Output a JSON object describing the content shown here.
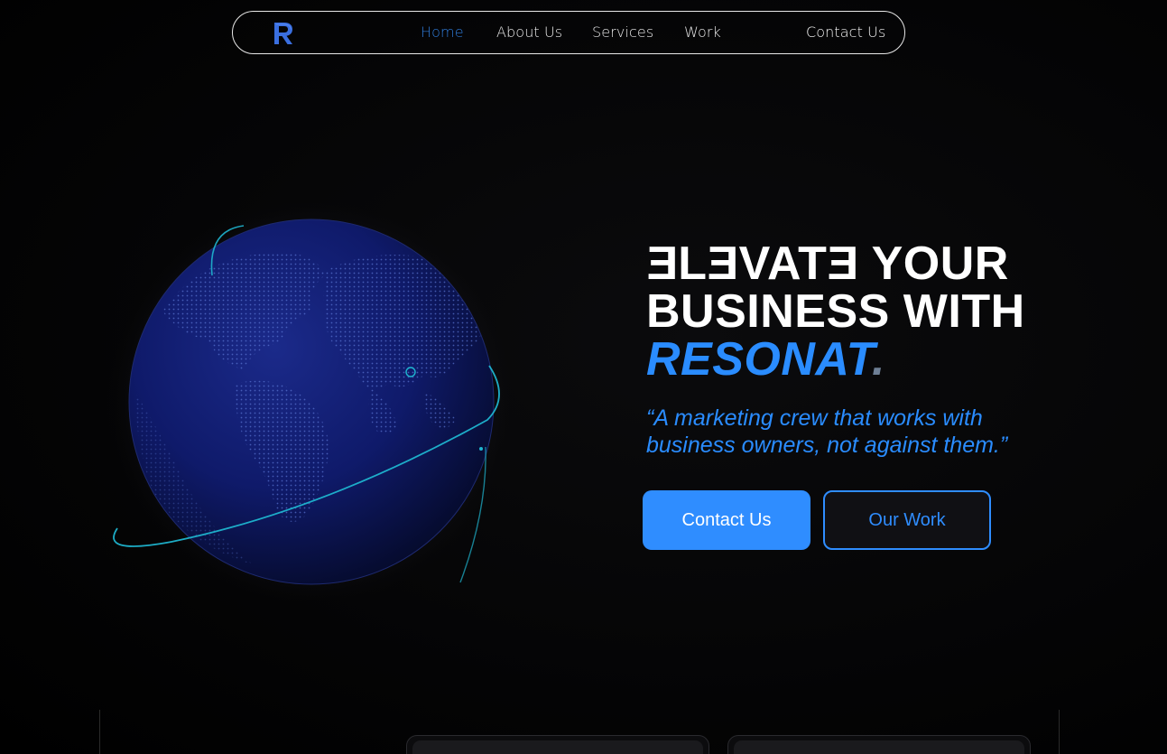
{
  "nav": {
    "logo_letter": "R",
    "items": [
      {
        "label": "Home",
        "active": true
      },
      {
        "label": "About Us",
        "active": false
      },
      {
        "label": "Services",
        "active": false
      },
      {
        "label": "Work",
        "active": false
      }
    ],
    "contact_label": "Contact Us"
  },
  "hero": {
    "headline_line1_rest": "YOUR",
    "headline_line2": "BUSINESS WITH",
    "brand": "RESONAT",
    "brand_dot": ".",
    "tagline": "“A marketing crew that works with business owners, not against them.”",
    "primary_button": "Contact Us",
    "secondary_button": "Our Work"
  },
  "colors": {
    "accent": "#2f8dff",
    "nav_active": "#2f7bd8",
    "globe": "#0e1a66",
    "orbit": "#1fb5d0",
    "background": "#000000"
  },
  "icons": {
    "logo": "resonat-logo-icon",
    "globe": "globe-illustration"
  }
}
